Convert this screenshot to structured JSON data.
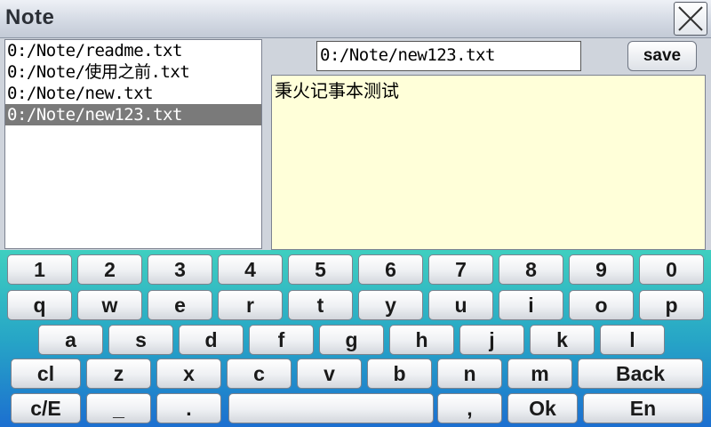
{
  "window": {
    "title": "Note"
  },
  "files": [
    {
      "path": "0:/Note/readme.txt",
      "selected": false
    },
    {
      "path": "0:/Note/使用之前.txt",
      "selected": false
    },
    {
      "path": "0:/Note/new.txt",
      "selected": false
    },
    {
      "path": "0:/Note/new123.txt",
      "selected": true
    }
  ],
  "editor": {
    "path_value": "0:/Note/new123.txt",
    "save_label": "save",
    "content": "秉火记事本测试"
  },
  "colors": {
    "editor_bg": "#ffffd9",
    "selected_item_bg": "#7a7a7a",
    "keyboard_gradient_top": "#3fcfc0",
    "keyboard_gradient_bottom": "#1c6fd0"
  },
  "keyboard": {
    "rows": [
      [
        "1",
        "2",
        "3",
        "4",
        "5",
        "6",
        "7",
        "8",
        "9",
        "0"
      ],
      [
        "q",
        "w",
        "e",
        "r",
        "t",
        "y",
        "u",
        "i",
        "o",
        "p"
      ],
      [
        "a",
        "s",
        "d",
        "f",
        "g",
        "h",
        "j",
        "k",
        "l"
      ],
      [
        "cl",
        "z",
        "x",
        "c",
        "v",
        "b",
        "n",
        "m",
        "Back"
      ],
      [
        "c/E",
        "_",
        ".",
        "",
        ",",
        "Ok",
        "En"
      ]
    ]
  }
}
